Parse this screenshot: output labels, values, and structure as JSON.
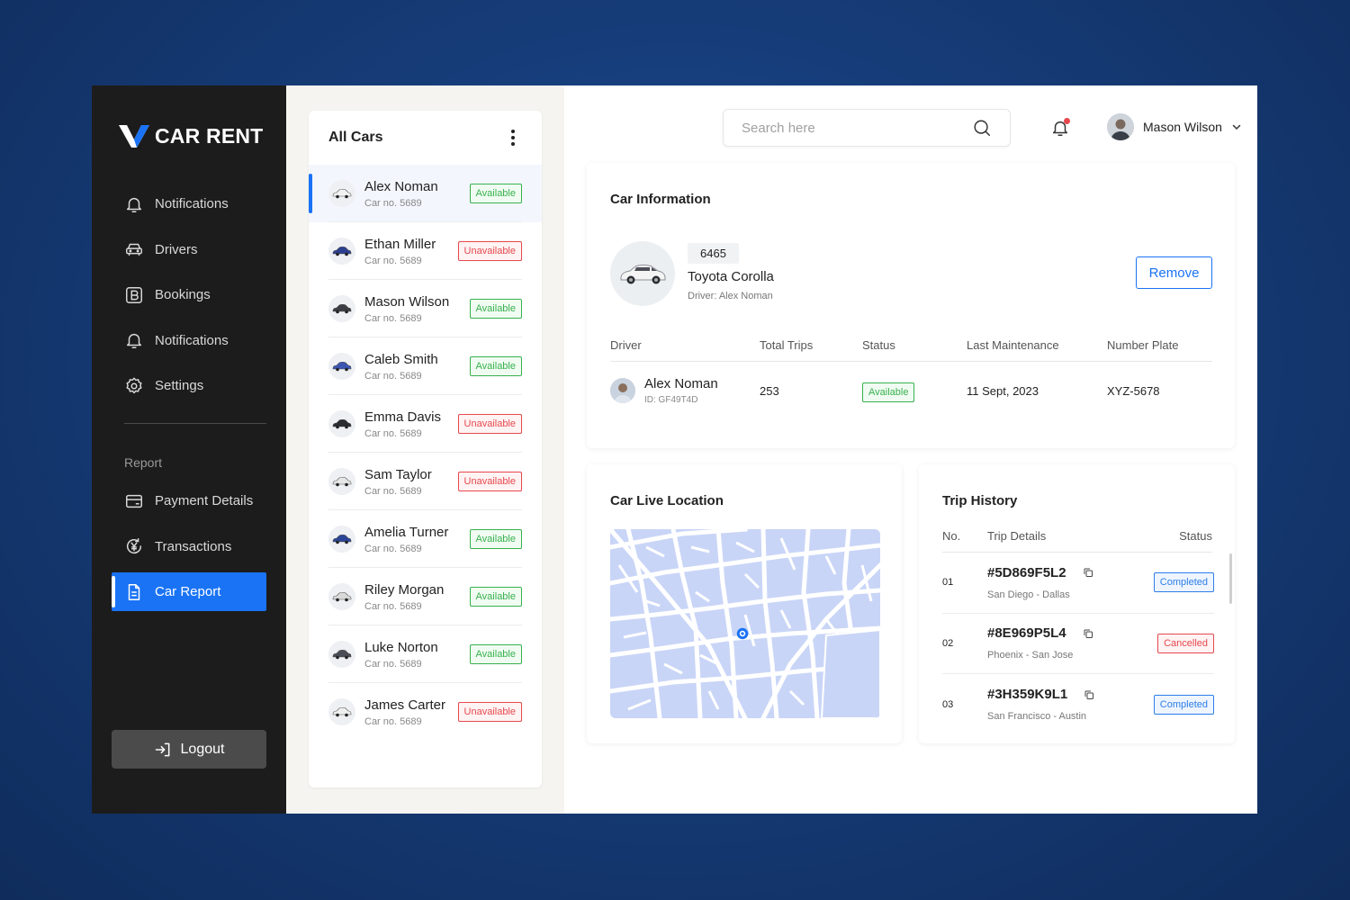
{
  "brand": {
    "logo_text": "CAR RENT"
  },
  "sidebar": {
    "items": [
      {
        "label": "Notifications",
        "icon": "bell-icon"
      },
      {
        "label": "Drivers",
        "icon": "car-icon"
      },
      {
        "label": "Bookings",
        "icon": "bookings-icon"
      },
      {
        "label": "Notifications",
        "icon": "bell-icon"
      },
      {
        "label": "Settings",
        "icon": "gear-icon"
      }
    ],
    "section_label": "Report",
    "report_items": [
      {
        "label": "Payment Details",
        "icon": "card-icon"
      },
      {
        "label": "Transactions",
        "icon": "currency-icon"
      },
      {
        "label": "Car Report",
        "icon": "document-icon",
        "active": true
      }
    ],
    "logout_label": "Logout"
  },
  "car_list": {
    "title": "All Cars",
    "cars": [
      {
        "name": "Alex Noman",
        "car_no": "Car no. 5689",
        "status": "Available"
      },
      {
        "name": "Ethan Miller",
        "car_no": "Car no. 5689",
        "status": "Unavailable"
      },
      {
        "name": "Mason Wilson",
        "car_no": "Car no. 5689",
        "status": "Available"
      },
      {
        "name": "Caleb Smith",
        "car_no": "Car no. 5689",
        "status": "Available"
      },
      {
        "name": "Emma Davis",
        "car_no": "Car no. 5689",
        "status": "Unavailable"
      },
      {
        "name": "Sam Taylor",
        "car_no": "Car no. 5689",
        "status": "Unavailable"
      },
      {
        "name": "Amelia Turner",
        "car_no": "Car no. 5689",
        "status": "Available"
      },
      {
        "name": "Riley Morgan",
        "car_no": "Car no. 5689",
        "status": "Available"
      },
      {
        "name": "Luke Norton",
        "car_no": "Car no. 5689",
        "status": "Available"
      },
      {
        "name": "James Carter",
        "car_no": "Car no. 5689",
        "status": "Unavailable"
      }
    ]
  },
  "header": {
    "search_placeholder": "Search here",
    "user_name": "Mason Wilson"
  },
  "car_info": {
    "title": "Car Information",
    "car_id": "6465",
    "model": "Toyota Corolla",
    "driver_line": "Driver: Alex Noman",
    "remove_label": "Remove",
    "columns": [
      "Driver",
      "Total Trips",
      "Status",
      "Last Maintenance",
      "Number Plate"
    ],
    "row": {
      "driver_name": "Alex Noman",
      "driver_id": "ID: GF49T4D",
      "total_trips": "253",
      "status": "Available",
      "last_maintenance": "11 Sept, 2023",
      "number_plate": "XYZ-5678"
    }
  },
  "live_location": {
    "title": "Car Live Location"
  },
  "trip_history": {
    "title": "Trip History",
    "columns": [
      "No.",
      "Trip Details",
      "Status"
    ],
    "trips": [
      {
        "no": "01",
        "code": "#5D869F5L2",
        "route": "San Diego - Dallas",
        "status": "Completed"
      },
      {
        "no": "02",
        "code": "#8E969P5L4",
        "route": "Phoenix - San Jose",
        "status": "Cancelled"
      },
      {
        "no": "03",
        "code": "#3H359K9L1",
        "route": "San Francisco - Austin",
        "status": "Completed"
      }
    ]
  },
  "colors": {
    "accent": "#1a73f5",
    "sidebar_bg": "#1c1c1c",
    "available": "#37b24d",
    "unavailable": "#e5484d",
    "map_fill": "#c9d5f7"
  }
}
